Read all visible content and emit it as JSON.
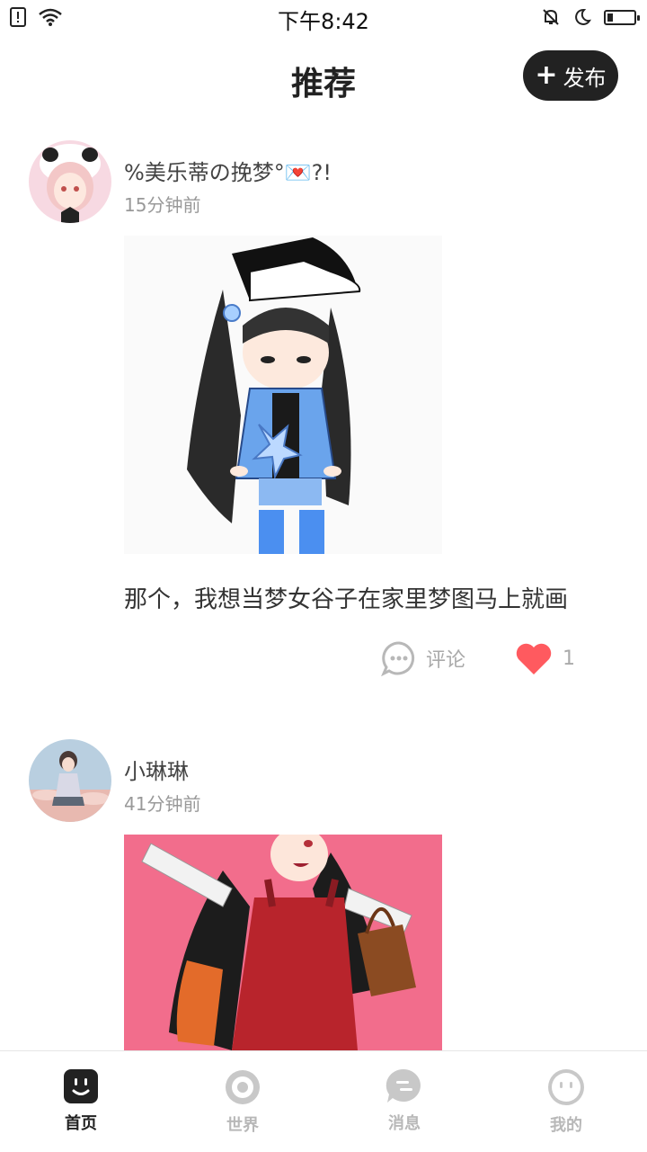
{
  "status_bar": {
    "time": "下午8:42"
  },
  "header": {
    "title": "推荐",
    "publish_label": "发布"
  },
  "posts": [
    {
      "username": "%美乐蒂の挽梦°💌?!",
      "time": "15分钟前",
      "text": "那个，我想当梦女谷子在家里梦图马上就画",
      "comment_label": "评论",
      "like_count": "1"
    },
    {
      "username": "小琳琳",
      "time": "41分钟前"
    }
  ],
  "tabs": [
    {
      "label": "首页",
      "icon": "home-face-icon",
      "active": true
    },
    {
      "label": "世界",
      "icon": "world-ring-icon",
      "active": false
    },
    {
      "label": "消息",
      "icon": "message-bubble-icon",
      "active": false
    },
    {
      "label": "我的",
      "icon": "profile-face-icon",
      "active": false
    }
  ],
  "colors": {
    "like": "#ff5a5f",
    "publish_bg": "#222222",
    "pink_bg": "#f26d8c"
  }
}
